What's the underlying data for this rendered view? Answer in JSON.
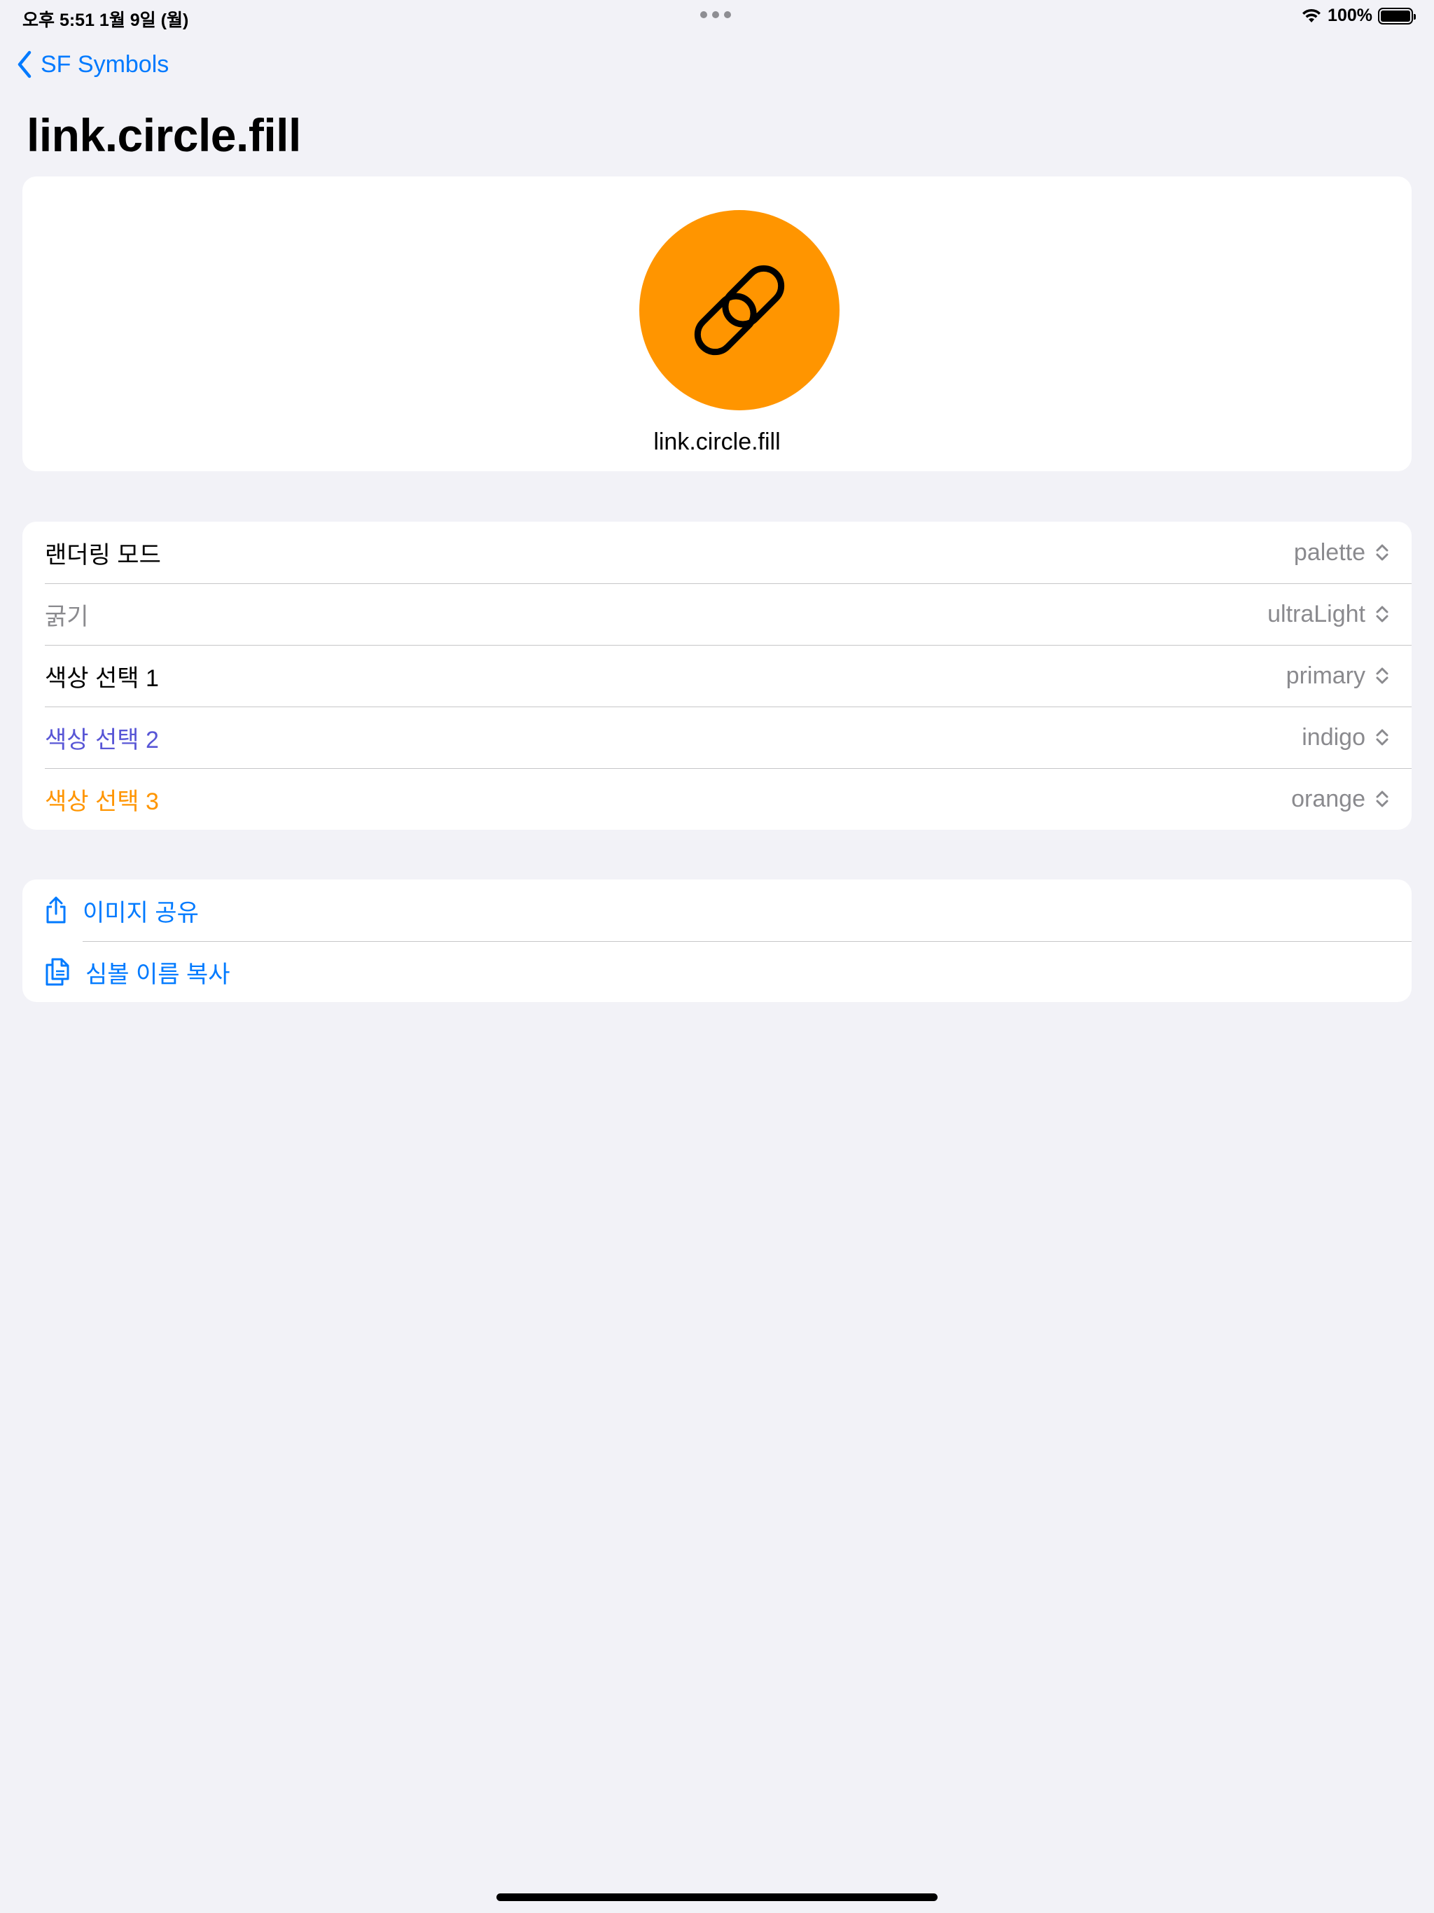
{
  "status_bar": {
    "time": "오후 5:51   1월 9일 (월)",
    "battery": "100%",
    "battery_level": 1.0
  },
  "nav": {
    "back_label": "SF Symbols"
  },
  "page": {
    "title": "link.circle.fill"
  },
  "preview": {
    "symbol_name": "link.circle.fill",
    "circle_color": "#ff9500",
    "glyph_color": "#000000",
    "icon": "link-icon"
  },
  "settings": {
    "rows": [
      {
        "label": "랜더링 모드",
        "value": "palette",
        "label_color": "#000000"
      },
      {
        "label": "굵기",
        "value": "ultraLight",
        "label_color": "#8a8a8e"
      },
      {
        "label": "색상 선택 1",
        "value": "primary",
        "label_color": "#000000"
      },
      {
        "label": "색상 선택 2",
        "value": "indigo",
        "label_color": "#5856d6"
      },
      {
        "label": "색상 선택 3",
        "value": "orange",
        "label_color": "#ff9500"
      }
    ]
  },
  "actions": {
    "share_label": "이미지 공유",
    "share_icon": "share-icon",
    "copy_label": "심볼 이름 복사",
    "copy_icon": "copy-icon"
  },
  "colors": {
    "accent": "#007aff",
    "background": "#f2f2f7",
    "secondary_text": "#8a8a8e"
  }
}
